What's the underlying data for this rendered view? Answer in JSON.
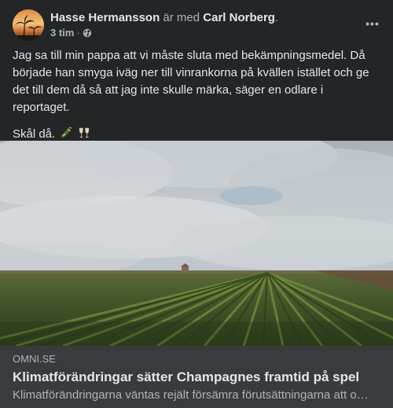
{
  "post": {
    "author": "Hasse Hermansson",
    "with_text": " är med ",
    "tagged": "Carl Norberg",
    "tagged_suffix": ".",
    "time": "3 tim",
    "separator": "·",
    "privacy_icon": "globe-icon",
    "more_label": "•••",
    "body_paragraph_1": "Jag sa till min pappa att vi måste sluta med bekämpningsmedel. Då började han smyga iväg ner till vinrankorna på kvällen istället och ge det till dem då så att jag inte skulle märka, säger en odlare i reportaget.",
    "body_paragraph_2": "Skål då."
  },
  "link": {
    "domain": "OMNI.SE",
    "title": "Klimatförändringar sätter Champagnes framtid på spel",
    "description": "Klimatförändringarna väntas rejält försämra förutsättningarna att o…"
  },
  "icons": {
    "emoji_1": "champagne-bottle-icon",
    "emoji_2": "clinking-glasses-icon"
  },
  "colors": {
    "background": "#242526",
    "link_panel": "#3a3b3c",
    "primary_text": "#e4e6eb",
    "secondary_text": "#b0b3b8"
  }
}
